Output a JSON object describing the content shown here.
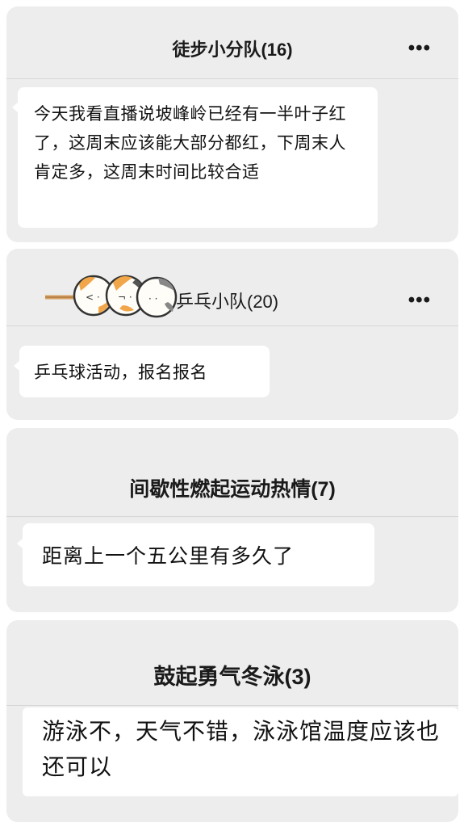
{
  "cards": [
    {
      "title": "徒步小分队(16)",
      "more": "•••",
      "message": "今天我看直播说坡峰岭已经有一半叶子红了，这周末应该能大部分都红，下周末人肯定多，这周末时间比较合适"
    },
    {
      "title": "乒乓小队(20)",
      "more": "•••",
      "message": "乒乓球活动，报名报名",
      "sticker_icon": "dango-cats-sticker-icon"
    },
    {
      "title": "间歇性燃起运动热情(7)",
      "message": "距离上一个五公里有多久了"
    },
    {
      "title": "鼓起勇气冬泳(3)",
      "message": "游泳不，天气不错，泳泳馆温度应该也还可以"
    }
  ],
  "colors": {
    "card_bg": "#ededed",
    "bubble_bg": "#ffffff",
    "divider": "#d6d6d6",
    "text": "#111111"
  }
}
